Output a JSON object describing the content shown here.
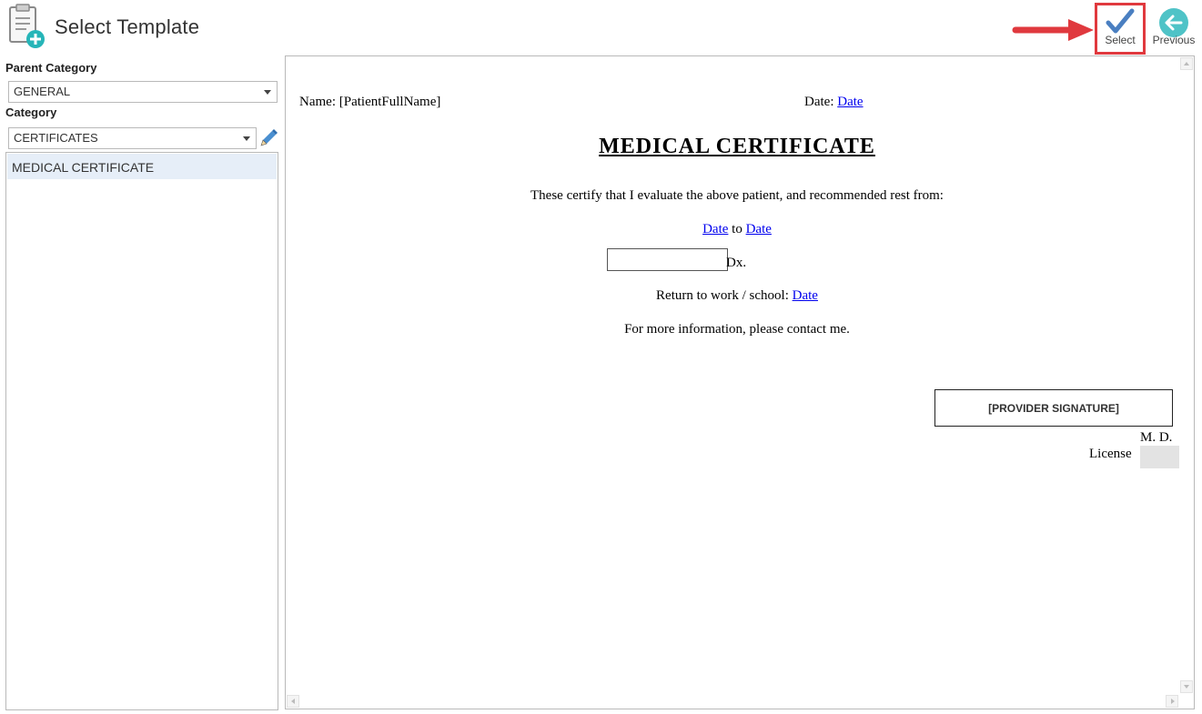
{
  "header": {
    "title": "Select Template",
    "select_label": "Select",
    "previous_label": "Previous"
  },
  "sidebar": {
    "parent_category_label": "Parent Category",
    "parent_category_value": "GENERAL",
    "category_label": "Category",
    "category_value": "CERTIFICATES",
    "templates": [
      "MEDICAL CERTIFICATE"
    ]
  },
  "document": {
    "name_label": "Name: [PatientFullName]",
    "date_label": "Date:",
    "date_link": "Date",
    "title": "MEDICAL CERTIFICATE",
    "certify_text": "These certify that I evaluate the above patient, and recommended rest from:",
    "rest_from": "Date",
    "rest_to_word": "to",
    "rest_to": "Date",
    "dx_label": "Dx.",
    "return_label": "Return to work / school:",
    "return_date": "Date",
    "contact_text": "For more information, please contact me.",
    "signature_placeholder": "[PROVIDER SIGNATURE]",
    "md_label": "M. D.",
    "license_label": "License"
  },
  "colors": {
    "highlight_border": "#e0393e",
    "arrow": "#e0393e",
    "check": "#4a7fc1",
    "previous_circle": "#4fc3c7",
    "list_selected": "#e6eef8",
    "link": "#0000ee"
  },
  "icons": {
    "app": "document-add-icon",
    "select": "checkmark-icon",
    "previous": "arrow-left-circle-icon",
    "edit": "pencil-icon"
  }
}
